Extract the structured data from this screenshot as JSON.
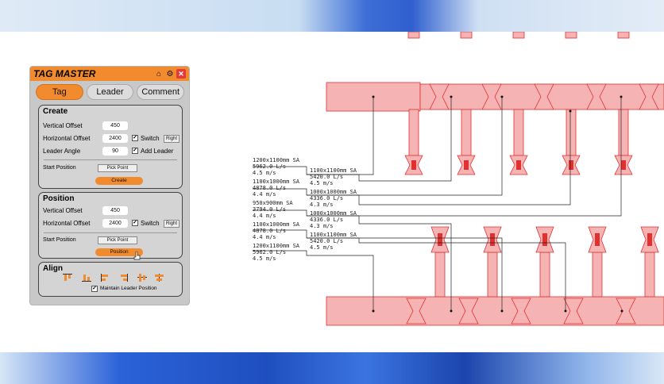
{
  "app": {
    "title": "TAG MASTER"
  },
  "tabs": [
    {
      "label": "Tag"
    },
    {
      "label": "Leader"
    },
    {
      "label": "Comment"
    }
  ],
  "create": {
    "title": "Create",
    "vertical_offset_label": "Vertical Offset",
    "vertical_offset": "450",
    "horizontal_offset_label": "Horizontal Offset",
    "horizontal_offset": "2400",
    "switch_label": "Switch",
    "right_label": "Right",
    "leader_angle_label": "Leader Angle",
    "leader_angle": "90",
    "add_leader_label": "Add Leader",
    "start_position_label": "Start Position",
    "pick_point_label": "Pick Point",
    "create_button": "Create"
  },
  "position": {
    "title": "Position",
    "vertical_offset_label": "Vertical Offset",
    "vertical_offset": "450",
    "horizontal_offset_label": "Horizontal Offset",
    "horizontal_offset": "2400",
    "switch_label": "Switch",
    "right_label": "Right",
    "start_position_label": "Start Position",
    "pick_point_label": "Pick Point",
    "position_button": "Position"
  },
  "align": {
    "title": "Align",
    "maintain_label": "Maintain Leader Position"
  },
  "icons": [
    "home-icon",
    "gear-icon",
    "close-icon"
  ],
  "colors": {
    "accent": "#f28a2e",
    "duct": "#f5b3b3",
    "duct_stroke": "#e03030"
  },
  "tags": {
    "left": [
      "1200x1100mm SA\n5962.0 L/s\n4.5 m/s",
      "1100x1000mm SA\n4878.0 L/s\n4.4 m/s",
      "950x900mm SA\n3794.0 L/s\n4.4 m/s",
      "1100x1000mm SA\n4878.0 L/s\n4.4 m/s",
      "1200x1100mm SA\n5962.0 L/s\n4.5 m/s"
    ],
    "right": [
      "1100x1100mm SA\n5420.0 L/s\n4.5 m/s",
      "1000x1000mm SA\n4336.0 L/s\n4.3 m/s",
      "1000x1000mm SA\n4336.0 L/s\n4.3 m/s",
      "1100x1100mm SA\n5420.0 L/s\n4.5 m/s"
    ]
  }
}
